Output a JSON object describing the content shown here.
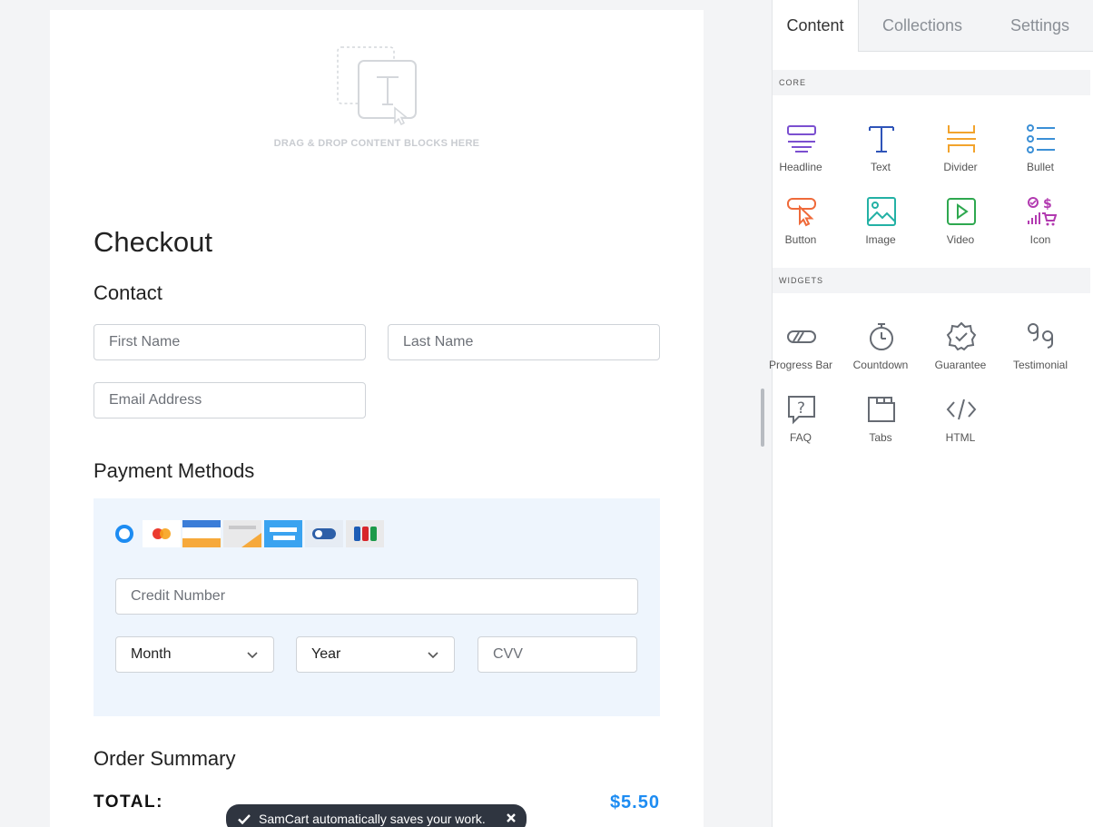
{
  "canvas": {
    "drop_text": "DRAG & DROP CONTENT BLOCKS HERE",
    "checkout_title": "Checkout",
    "contact": {
      "title": "Contact",
      "first_name_placeholder": "First Name",
      "last_name_placeholder": "Last Name",
      "email_placeholder": "Email Address"
    },
    "payment": {
      "title": "Payment Methods",
      "card_logos": [
        "mastercard-icon",
        "card-blue-orange-icon",
        "card-gray-icon",
        "card-lightblue-icon",
        "toggle-card-icon",
        "jcb-icon"
      ],
      "credit_number_placeholder": "Credit Number",
      "month_value": "Month",
      "year_value": "Year",
      "cvv_placeholder": "CVV"
    },
    "order_summary": {
      "title": "Order Summary",
      "total_label": "TOTAL:",
      "total_value": "$5.50"
    },
    "accent_color": "#1d8cf2"
  },
  "toast": {
    "message": "SamCart automatically saves your work."
  },
  "panel": {
    "tabs": [
      {
        "label": "Content",
        "active": true
      },
      {
        "label": "Collections",
        "active": false
      },
      {
        "label": "Settings",
        "active": false
      }
    ],
    "core": {
      "title": "CORE",
      "blocks": [
        {
          "label": "Headline",
          "icon": "headline-icon"
        },
        {
          "label": "Text",
          "icon": "text-icon"
        },
        {
          "label": "Divider",
          "icon": "divider-icon"
        },
        {
          "label": "Bullet",
          "icon": "bullet-icon"
        },
        {
          "label": "Button",
          "icon": "button-icon"
        },
        {
          "label": "Image",
          "icon": "image-icon"
        },
        {
          "label": "Video",
          "icon": "video-icon"
        },
        {
          "label": "Icon",
          "icon": "icon-icon"
        }
      ]
    },
    "widgets": {
      "title": "WIDGETS",
      "blocks": [
        {
          "label": "Progress Bar",
          "icon": "progress-bar-icon"
        },
        {
          "label": "Countdown",
          "icon": "countdown-icon"
        },
        {
          "label": "Guarantee",
          "icon": "guarantee-icon"
        },
        {
          "label": "Testimonial",
          "icon": "testimonial-icon"
        },
        {
          "label": "FAQ",
          "icon": "faq-icon"
        },
        {
          "label": "Tabs",
          "icon": "tabs-icon"
        },
        {
          "label": "HTML",
          "icon": "html-icon"
        }
      ]
    }
  }
}
